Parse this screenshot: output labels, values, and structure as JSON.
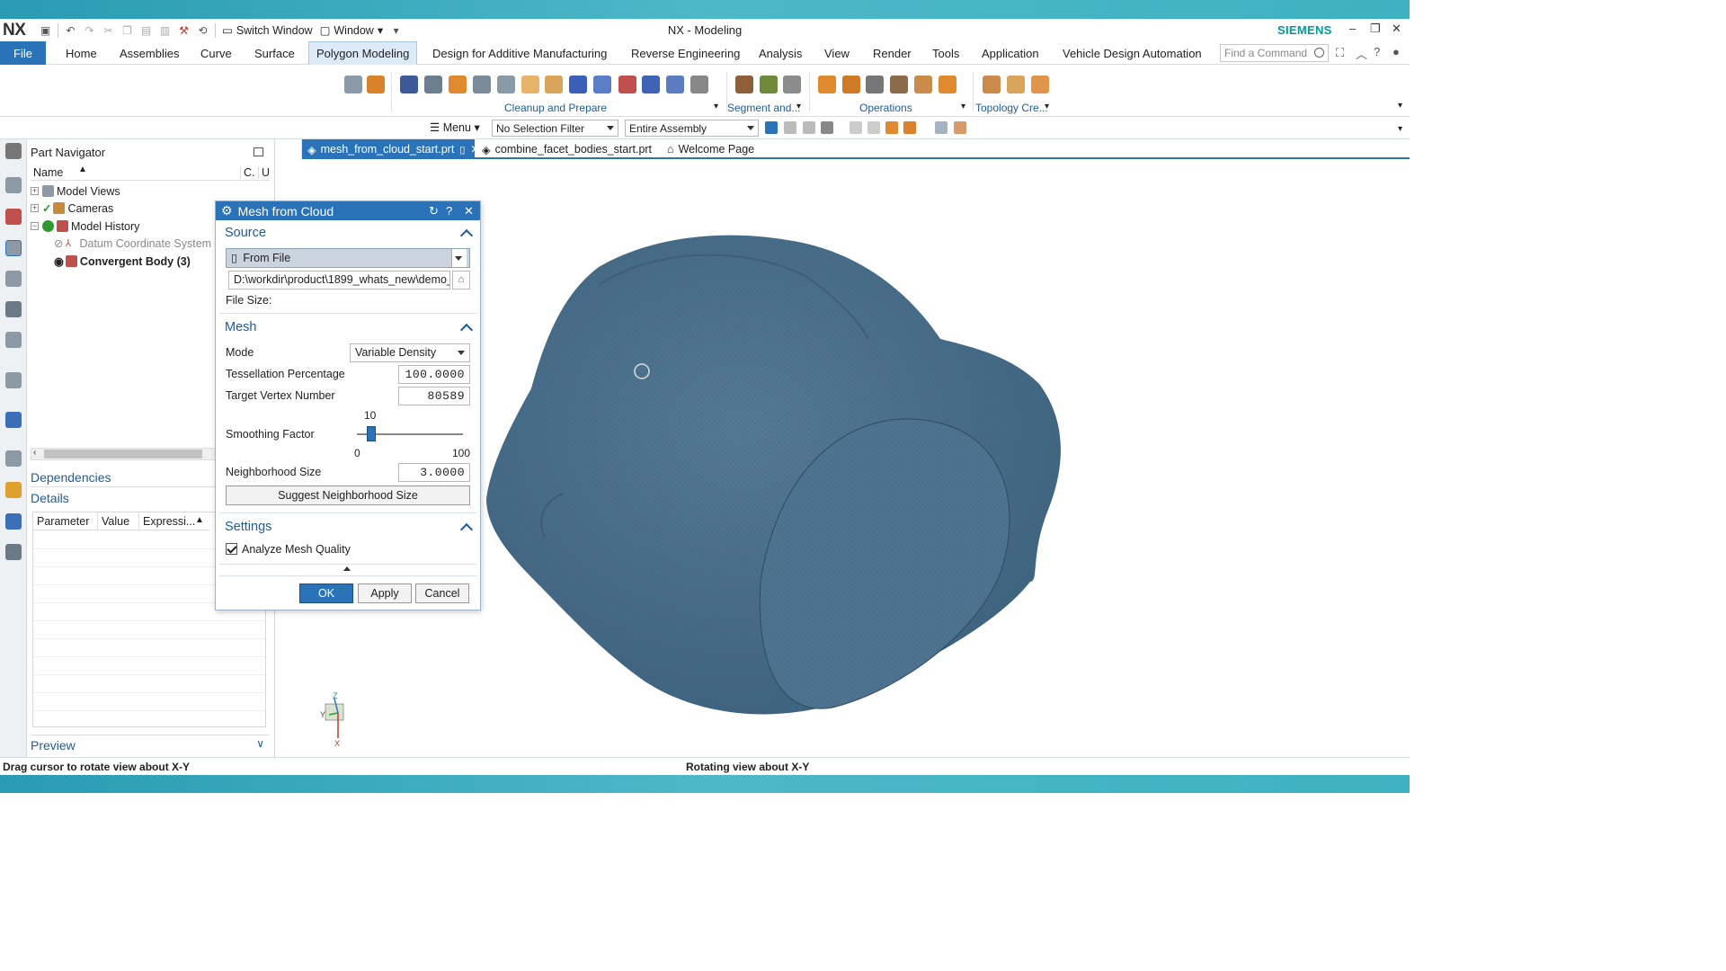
{
  "app": {
    "logo": "NX",
    "window_title": "NX - Modeling",
    "brand": "SIEMENS",
    "quick_access": {
      "switch_window": "Switch Window",
      "window": "Window"
    }
  },
  "menu": {
    "file": "File",
    "tabs": [
      "Home",
      "Assemblies",
      "Curve",
      "Surface",
      "Polygon Modeling",
      "Design for Additive Manufacturing",
      "Reverse Engineering",
      "Analysis",
      "View",
      "Render",
      "Tools",
      "Application",
      "Vehicle Design Automation"
    ],
    "active_tab": "Polygon Modeling",
    "find_placeholder": "Find a Command"
  },
  "ribbon": {
    "groups": [
      "Cleanup and Prepare",
      "Segment and...",
      "Operations",
      "Topology Cre..."
    ]
  },
  "selection_bar": {
    "menu": "Menu",
    "selection_filter": "No Selection Filter",
    "scope": "Entire Assembly"
  },
  "part_navigator": {
    "title": "Part Navigator",
    "columns": [
      "Name",
      "C.",
      "U"
    ],
    "items": [
      {
        "label": "Model Views"
      },
      {
        "label": "Cameras"
      },
      {
        "label": "Model History"
      },
      {
        "label": "Datum Coordinate System"
      },
      {
        "label": "Convergent Body (3)"
      }
    ],
    "dependencies": "Dependencies",
    "details": "Details",
    "details_columns": [
      "Parameter",
      "Value",
      "Expressi..."
    ],
    "preview": "Preview"
  },
  "doc_tabs": [
    "mesh_from_cloud_start.prt",
    "combine_facet_bodies_start.prt",
    "Welcome Page"
  ],
  "dialog": {
    "title": "Mesh from Cloud",
    "source": {
      "header": "Source",
      "type": "From File",
      "path": "D:\\workdir\\product\\1899_whats_new\\demo_",
      "file_size_label": "File Size:"
    },
    "mesh": {
      "header": "Mesh",
      "mode_label": "Mode",
      "mode_value": "Variable Density",
      "tess_label": "Tessellation Percentage",
      "tess_value": "100.0000",
      "vertex_label": "Target Vertex Number",
      "vertex_value": "80589",
      "smoothing_label": "Smoothing Factor",
      "smoothing_value": "10",
      "smoothing_min": "0",
      "smoothing_max": "100",
      "smoothing_level": 0.1,
      "neighborhood_label": "Neighborhood Size",
      "neighborhood_value": "3.0000",
      "suggest_button": "Suggest Neighborhood Size"
    },
    "settings": {
      "header": "Settings",
      "analyze_label": "Analyze Mesh Quality",
      "analyze_checked": true
    },
    "buttons": {
      "ok": "OK",
      "apply": "Apply",
      "cancel": "Cancel"
    }
  },
  "status": {
    "left": "Drag cursor to rotate view about X-Y",
    "center": "Rotating view about X-Y"
  },
  "colors": {
    "accent": "#2b73b8",
    "brand": "#009999",
    "mesh": "#4a6f8a"
  }
}
